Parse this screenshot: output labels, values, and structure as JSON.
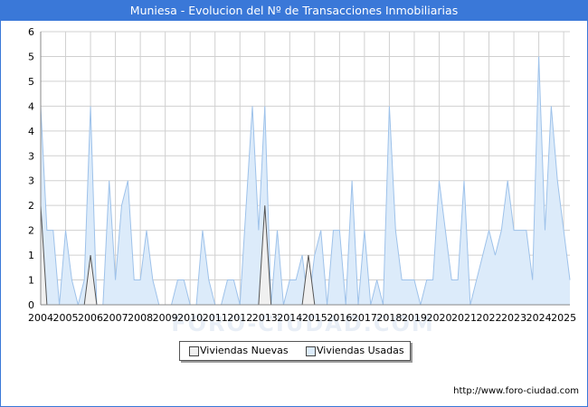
{
  "title": "Muniesa - Evolucion del Nº de Transacciones Inmobiliarias",
  "source_url": "http://www.foro-ciudad.com",
  "watermark": "FORO-CIUDAD.COM",
  "colors": {
    "title_bar": "#3a78d8",
    "nuevas_fill": "#f0f0f0",
    "nuevas_line": "#555555",
    "usadas_fill": "#dcebfa",
    "usadas_line": "#9ec2ea",
    "grid": "#d0d0d0"
  },
  "chart_data": {
    "type": "area",
    "title": "Muniesa - Evolucion del Nº de Transacciones Inmobiliarias",
    "xlabel": "",
    "ylabel": "",
    "y_tick_labels": [
      "0",
      "1",
      "1",
      "2",
      "2",
      "3",
      "3",
      "4",
      "4",
      "5",
      "5",
      "6"
    ],
    "ylim": [
      0,
      5.5
    ],
    "x_tick_labels": [
      "2004",
      "2005",
      "2006",
      "2007",
      "2008",
      "2009",
      "2010",
      "2011",
      "2012",
      "2013",
      "2014",
      "2015",
      "2016",
      "2017",
      "2018",
      "2019",
      "2020",
      "2021",
      "2022",
      "2023",
      "2024",
      "2025"
    ],
    "x_range": [
      2004,
      2025.25
    ],
    "grid": true,
    "legend_position": "bottom-center",
    "series": [
      {
        "name": "Viviendas Nuevas",
        "x": [
          2004.0,
          2004.25,
          2005.75,
          2006.0,
          2006.25,
          2012.75,
          2013.0,
          2013.25,
          2014.5,
          2014.75,
          2015.0
        ],
        "values": [
          2,
          0,
          0,
          1,
          0,
          0,
          2,
          0,
          0,
          1,
          0
        ]
      },
      {
        "name": "Viviendas Usadas",
        "x": [
          2004.0,
          2004.25,
          2004.5,
          2004.75,
          2005.0,
          2005.25,
          2005.5,
          2005.75,
          2006.0,
          2006.25,
          2006.5,
          2006.75,
          2007.0,
          2007.25,
          2007.5,
          2007.75,
          2008.0,
          2008.25,
          2008.5,
          2008.75,
          2009.0,
          2009.25,
          2009.5,
          2009.75,
          2010.0,
          2010.25,
          2010.5,
          2010.75,
          2011.0,
          2011.25,
          2011.5,
          2011.75,
          2012.0,
          2012.25,
          2012.5,
          2012.75,
          2013.0,
          2013.25,
          2013.5,
          2013.75,
          2014.0,
          2014.25,
          2014.5,
          2014.75,
          2015.0,
          2015.25,
          2015.5,
          2015.75,
          2016.0,
          2016.25,
          2016.5,
          2016.75,
          2017.0,
          2017.25,
          2017.5,
          2017.75,
          2018.0,
          2018.25,
          2018.5,
          2018.75,
          2019.0,
          2019.25,
          2019.5,
          2019.75,
          2020.0,
          2020.25,
          2020.5,
          2020.75,
          2021.0,
          2021.25,
          2021.5,
          2021.75,
          2022.0,
          2022.25,
          2022.5,
          2022.75,
          2023.0,
          2023.25,
          2023.5,
          2023.75,
          2024.0,
          2024.25,
          2024.5,
          2024.75,
          2025.0,
          2025.25
        ],
        "values": [
          4,
          1.5,
          1.5,
          0,
          1.5,
          0.5,
          0,
          0.5,
          4,
          0,
          0,
          2.5,
          0.5,
          2,
          2.5,
          0.5,
          0.5,
          1.5,
          0.5,
          0,
          0,
          0,
          0.5,
          0.5,
          0,
          0,
          1.5,
          0.5,
          0,
          0,
          0.5,
          0.5,
          0,
          2,
          4,
          1.5,
          4,
          0,
          1.5,
          0,
          0.5,
          0.5,
          1,
          0,
          1,
          1.5,
          0,
          1.5,
          1.5,
          0,
          2.5,
          0,
          1.5,
          0,
          0.5,
          0,
          4,
          1.5,
          0.5,
          0.5,
          0.5,
          0,
          0.5,
          0.5,
          2.5,
          1.5,
          0.5,
          0.5,
          2.5,
          0,
          0.5,
          1,
          1.5,
          1,
          1.5,
          2.5,
          1.5,
          1.5,
          1.5,
          0.5,
          5,
          1.5,
          4,
          2.5,
          1.5,
          0.5
        ]
      }
    ]
  }
}
